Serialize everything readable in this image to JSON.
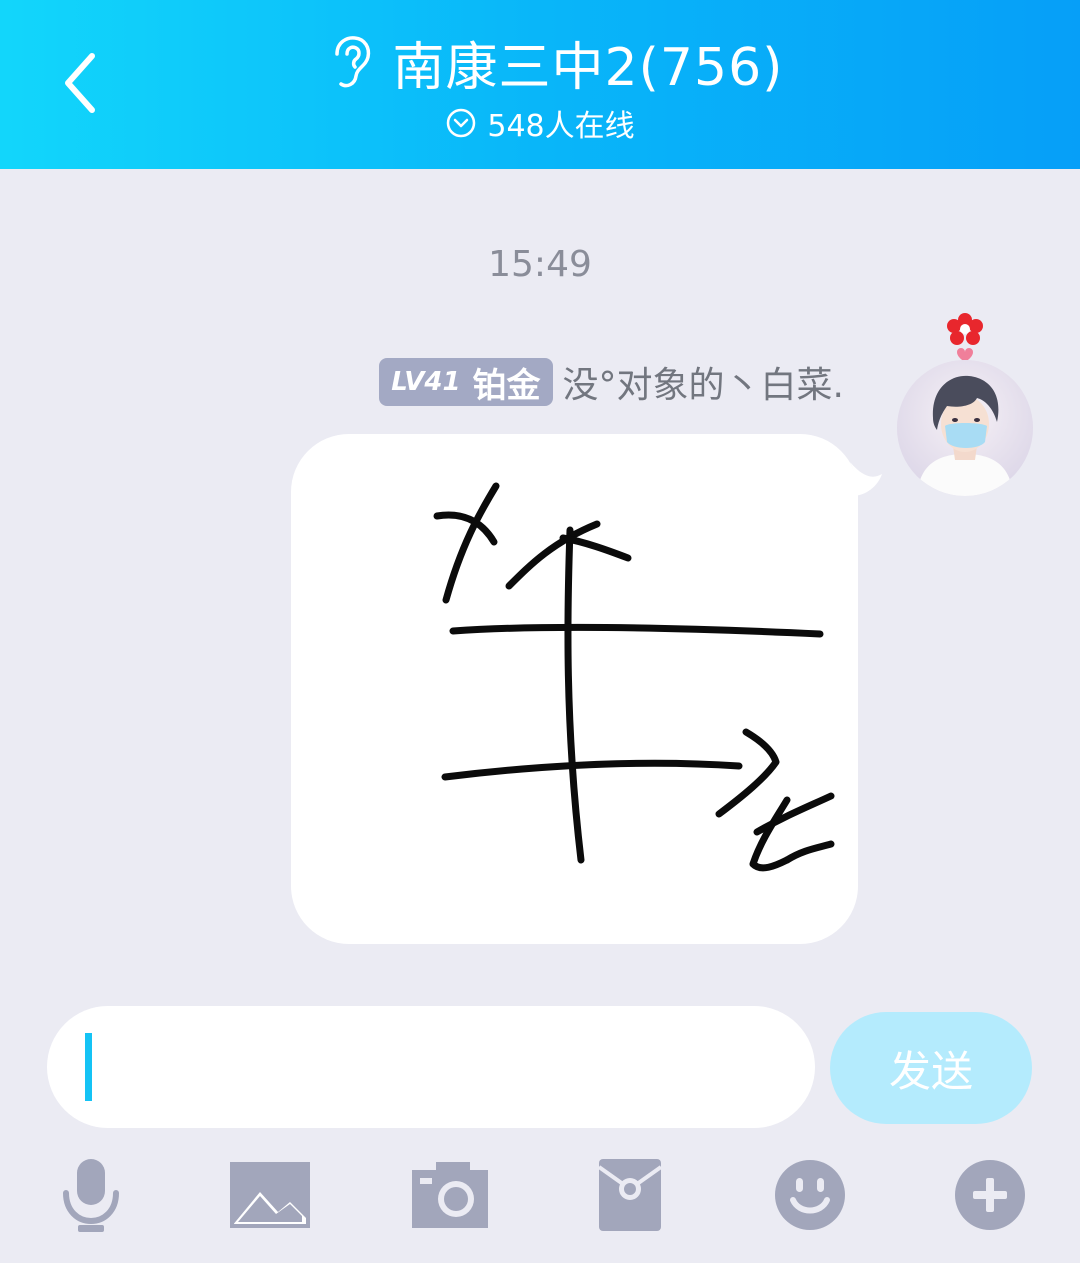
{
  "header": {
    "title": "南康三中2(756)",
    "online": "548人在线",
    "back_icon": "chevron-left-icon",
    "ear_icon": "ear-icon",
    "gradient_start": "#12d6fb",
    "gradient_end": "#069ff8"
  },
  "chat": {
    "timestamp": "15:49",
    "message": {
      "badge_level": "LV41",
      "badge_rank": "铂金",
      "sender": "没°对象的丶白菜.",
      "type": "handwriting-image",
      "drawing_labels": {
        "y_axis": "x",
        "x_axis": "t"
      }
    }
  },
  "composer": {
    "input_value": "",
    "send_label": "发送"
  },
  "toolbar": {
    "items": [
      "microphone-icon",
      "image-icon",
      "camera-icon",
      "red-envelope-icon",
      "emoji-icon",
      "plus-icon"
    ]
  }
}
